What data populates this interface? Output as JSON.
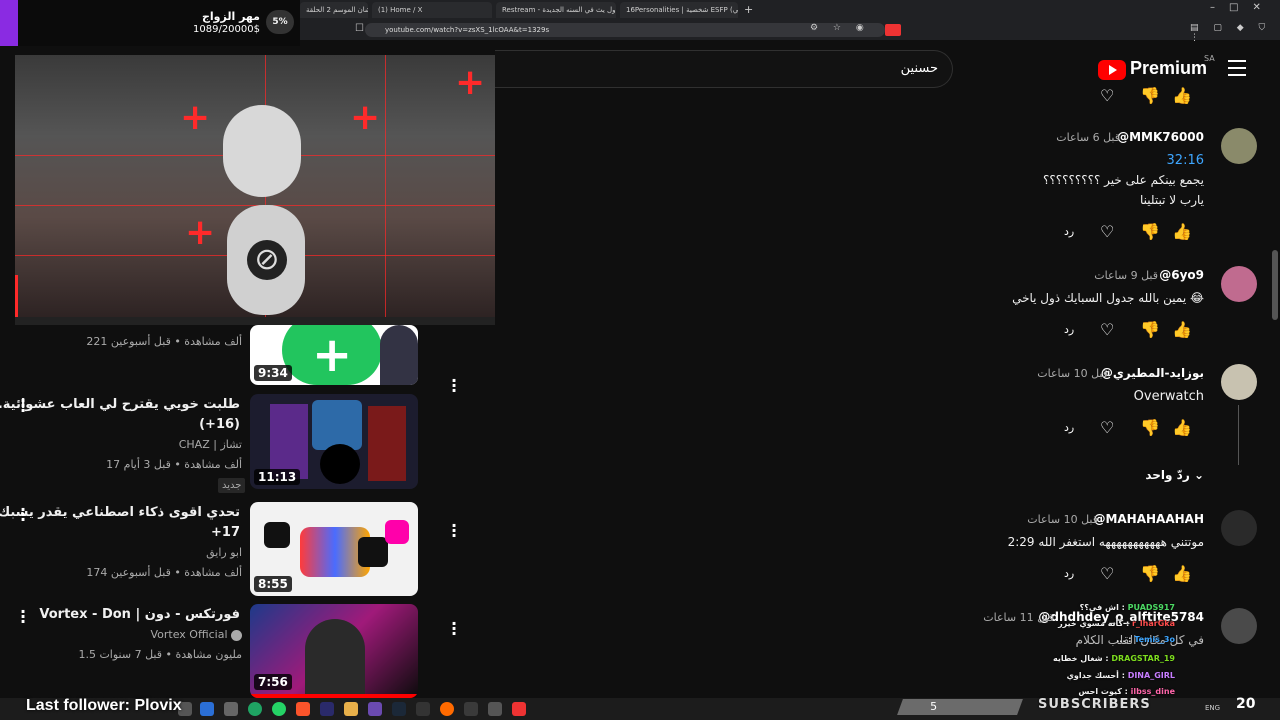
{
  "browser": {
    "tabs": [
      "جاكي شان الموسم 2 الحلقة",
      "(1) Home / X",
      "Restream - اول يث في السنه الجديدة",
      "16Personalities | شخصية ESFP (مسلي)"
    ],
    "new_tab": "+",
    "url": "youtube.com/watch?v=zsXS_1lcOAA&t=1329s"
  },
  "donation_goal": {
    "title": "مهر الزواج",
    "amount": "1089/20000$",
    "percent": "5%"
  },
  "header": {
    "search_query": "حسنين",
    "logo_text": "Premium",
    "region": "SA"
  },
  "related_videos": [
    {
      "title_lines": [
        "",
        ""
      ],
      "channel": "",
      "meta": "221 ألف مشاهدة • قبل أسبوعين",
      "duration": "9:34"
    },
    {
      "title_lines": [
        "طلبت خويي يقترح لي العاب عشوائية...",
        "(16+)"
      ],
      "channel": "CHAZ | تشاز",
      "meta": "17 ألف مشاهدة • قبل 3 أيام",
      "duration": "11:13",
      "badge": "جديد"
    },
    {
      "title_lines": [
        "تحدي اقوى ذكاء اصطناعي يقدر يسبك 😡 !",
        "17+"
      ],
      "channel": "ابو رايق",
      "meta": "174 ألف مشاهدة • قبل أسبوعين",
      "duration": "8:55"
    },
    {
      "title_lines": [
        "فورتكس - دون | Vortex - Don",
        ""
      ],
      "channel": "Vortex Official",
      "meta": "1.5 مليون مشاهدة • قبل 7 سنوات",
      "duration": "7:56"
    }
  ],
  "comments": [
    {
      "author": "@MMK76000",
      "time": "قبل 6 ساعات",
      "lines": [
        "32:16",
        "يجمع بينكم على خير ؟؟؟؟؟؟؟؟؟",
        "يارب لا تبتلينا"
      ],
      "reply": "رد"
    },
    {
      "author": "@6yo9",
      "time": "قبل 9 ساعات",
      "lines": [
        "يمين بالله جدول السبايك ذول ياخي 😂"
      ],
      "reply": "رد"
    },
    {
      "author": "@بوزايد-المطيري",
      "time": "قبل 10 ساعات",
      "lines": [
        "Overwatch"
      ],
      "reply": "رد",
      "replies_label": "ردّ واحد"
    },
    {
      "author": "@MAHAHAAHAH",
      "time": "قبل 10 ساعات",
      "lines": [
        "2:29 موتتني هههههههههههه استغفر الله"
      ],
      "reply": "رد"
    },
    {
      "author": "@dhdhdey_o_alftite5784",
      "time": "قبل 11 ساعات",
      "lines": [
        "في كل مكان القلب الكلام"
      ],
      "reply": "رد"
    }
  ],
  "stream_chat": [
    {
      "user": "PUADS917",
      "msg": "اش في؟؟",
      "color": "#4cd964"
    },
    {
      "user": "r_lharGka",
      "msg": "كأنه مسوي خيرر",
      "color": "#ff4d4d"
    },
    {
      "user": "Temis_3o",
      "msg": "...",
      "color": "#3ea6ff"
    },
    {
      "user": "DRAGSTAR_19",
      "msg": "شغال خطايه",
      "color": "#7ddc1f"
    },
    {
      "user": "DINA_GIRL",
      "msg": "أحسك جداوي",
      "color": "#c77dff"
    },
    {
      "user": "ilbss_dine",
      "msg": "كيوت احس",
      "color": "#ff66aa"
    }
  ],
  "stream": {
    "last_follower": "Last follower: Plovix",
    "subscribers_label": "SUBSCRIBERS",
    "sub_count": "20",
    "sub_bar_num": "5"
  },
  "colors": {
    "accent": "#ff0000",
    "link": "#3ea6ff",
    "goal_bar": "#8a2be2"
  }
}
